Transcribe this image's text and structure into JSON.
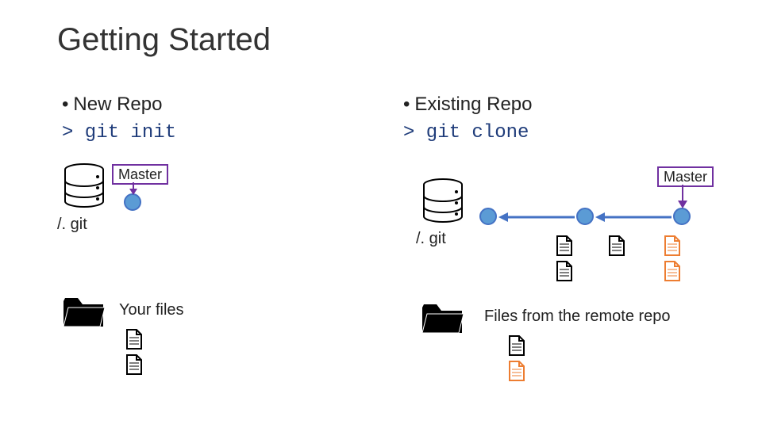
{
  "title": "Getting Started",
  "left": {
    "heading": "New Repo",
    "command": "> git init",
    "master_label": "Master",
    "git_label": "/. git",
    "files_label": "Your files"
  },
  "right": {
    "heading": "Existing Repo",
    "command": "> git clone",
    "master_label": "Master",
    "git_label": "/. git",
    "files_label": "Files from the remote repo"
  },
  "colors": {
    "purple": "#7030a0",
    "blue": "#4472c4",
    "lightblue": "#5b9bd5",
    "orange": "#ed7d31"
  }
}
